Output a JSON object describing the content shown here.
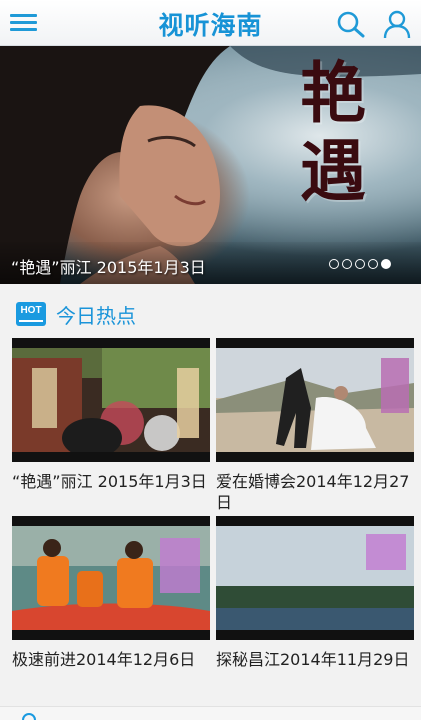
{
  "header": {
    "title": "视听海南",
    "menu_icon": "hamburger-menu-icon",
    "search_icon": "search-icon",
    "user_icon": "user-icon",
    "accent": "#1793d6"
  },
  "banner": {
    "calligraphy_1": "艳",
    "calligraphy_2": "遇",
    "caption": "“艳遇”丽江 2015年1月3日",
    "page_count": 5,
    "active_page": 5
  },
  "hot": {
    "badge": "HOT",
    "title": "今日热点",
    "items": [
      {
        "title": "“艳遇”丽江 2015年1月3日"
      },
      {
        "title": "爱在婚博会2014年12月27日"
      },
      {
        "title": "极速前进2014年12月6日"
      },
      {
        "title": "探秘昌江2014年11月29日"
      }
    ]
  }
}
